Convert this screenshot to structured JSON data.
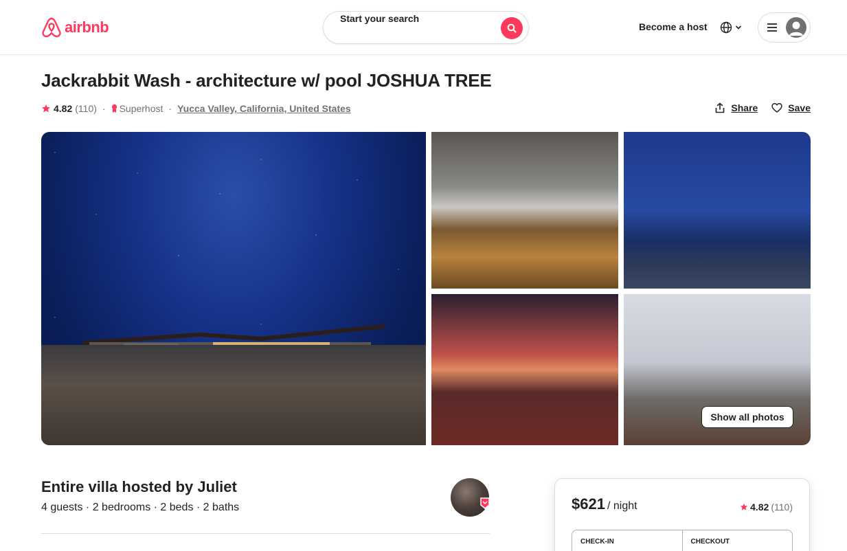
{
  "header": {
    "brand": "airbnb",
    "search_placeholder": "Start your search",
    "become_host": "Become a host"
  },
  "listing": {
    "title": "Jackrabbit Wash - architecture w/ pool JOSHUA TREE",
    "rating": "4.82",
    "reviews": "(110)",
    "superhost": "Superhost",
    "location": "Yucca Valley, California, United States",
    "share": "Share",
    "save": "Save",
    "show_all_photos": "Show all photos"
  },
  "host": {
    "title": "Entire villa hosted by Juliet",
    "details": "4 guests · 2 bedrooms · 2 beds · 2 baths"
  },
  "booking": {
    "price": "$621",
    "per_night": "/ night",
    "rating": "4.82",
    "reviews": "(110)",
    "check_in": "CHECK-IN",
    "checkout": "CHECKOUT"
  },
  "colors": {
    "brand": "#ff385c",
    "text": "#222222",
    "muted": "#717171"
  }
}
